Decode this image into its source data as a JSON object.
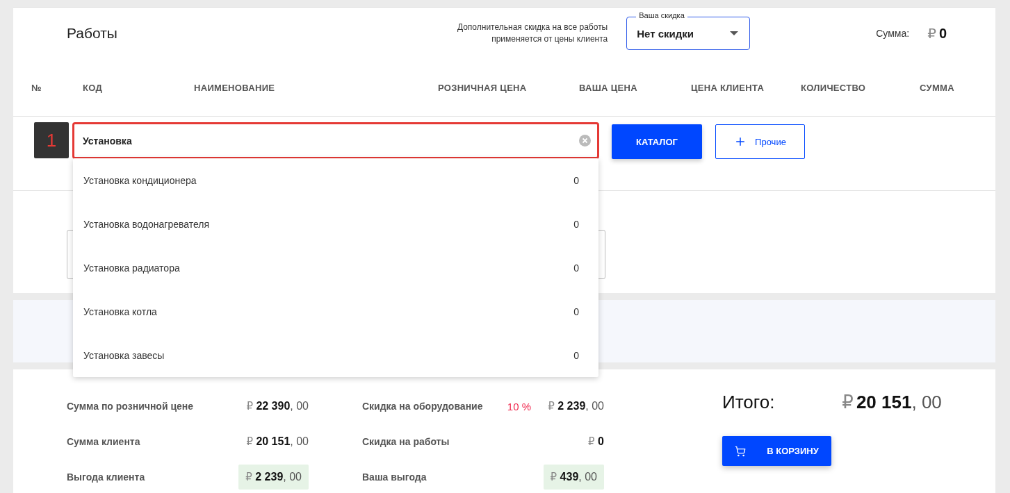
{
  "works": {
    "title": "Работы",
    "discount": {
      "note_lines": [
        "Дополнительная скидка на все работы",
        "применяется от цены клиента"
      ],
      "label": "Ваша скидка",
      "value": "Нет скидки"
    },
    "sum": {
      "label": "Сумма:",
      "currency": "₽",
      "amount": "0"
    },
    "columns": [
      "№",
      "КОД",
      "НАИМЕНОВАНИЕ",
      "РОЗНИЧНАЯ ЦЕНА",
      "ВАША ЦЕНА",
      "ЦЕНА КЛИЕНТА",
      "КОЛИЧЕСТВО",
      "СУММА"
    ],
    "entry": {
      "number": "1",
      "query": "Установка",
      "catalog_button": "КАТАЛОГ",
      "other_button": "Прочие"
    },
    "suggestions": [
      {
        "label": "Установка кондиционера",
        "value": "0"
      },
      {
        "label": "Установка водонагревателя",
        "value": "0"
      },
      {
        "label": "Установка радиатора",
        "value": "0"
      },
      {
        "label": "Установка котла",
        "value": "0"
      },
      {
        "label": "Установка завесы",
        "value": "0"
      }
    ]
  },
  "summary": {
    "left": [
      {
        "label": "Сумма по розничной цене",
        "currency": "₽",
        "whole": "22 390",
        "cents": ", 00",
        "highlighted": false
      },
      {
        "label": "Сумма клиента",
        "currency": "₽",
        "whole": "20 151",
        "cents": ", 00",
        "highlighted": false
      },
      {
        "label": "Выгода клиента",
        "currency": "₽",
        "whole": "2 239",
        "cents": ", 00",
        "highlighted": true
      }
    ],
    "right": [
      {
        "label": "Скидка на оборудование",
        "percent": "10 %",
        "currency": "₽",
        "whole": "2 239",
        "cents": ", 00",
        "highlighted": false
      },
      {
        "label": "Скидка на работы",
        "currency": "₽",
        "whole": "0",
        "highlighted": false
      },
      {
        "label": "Ваша выгода",
        "currency": "₽",
        "whole": "439",
        "cents": ", 00",
        "highlighted": true
      }
    ],
    "grand_total": {
      "label": "Итого:",
      "currency": "₽",
      "whole": "20 151",
      "cents": ", 00"
    },
    "cart_button": "В КОРЗИНУ"
  }
}
